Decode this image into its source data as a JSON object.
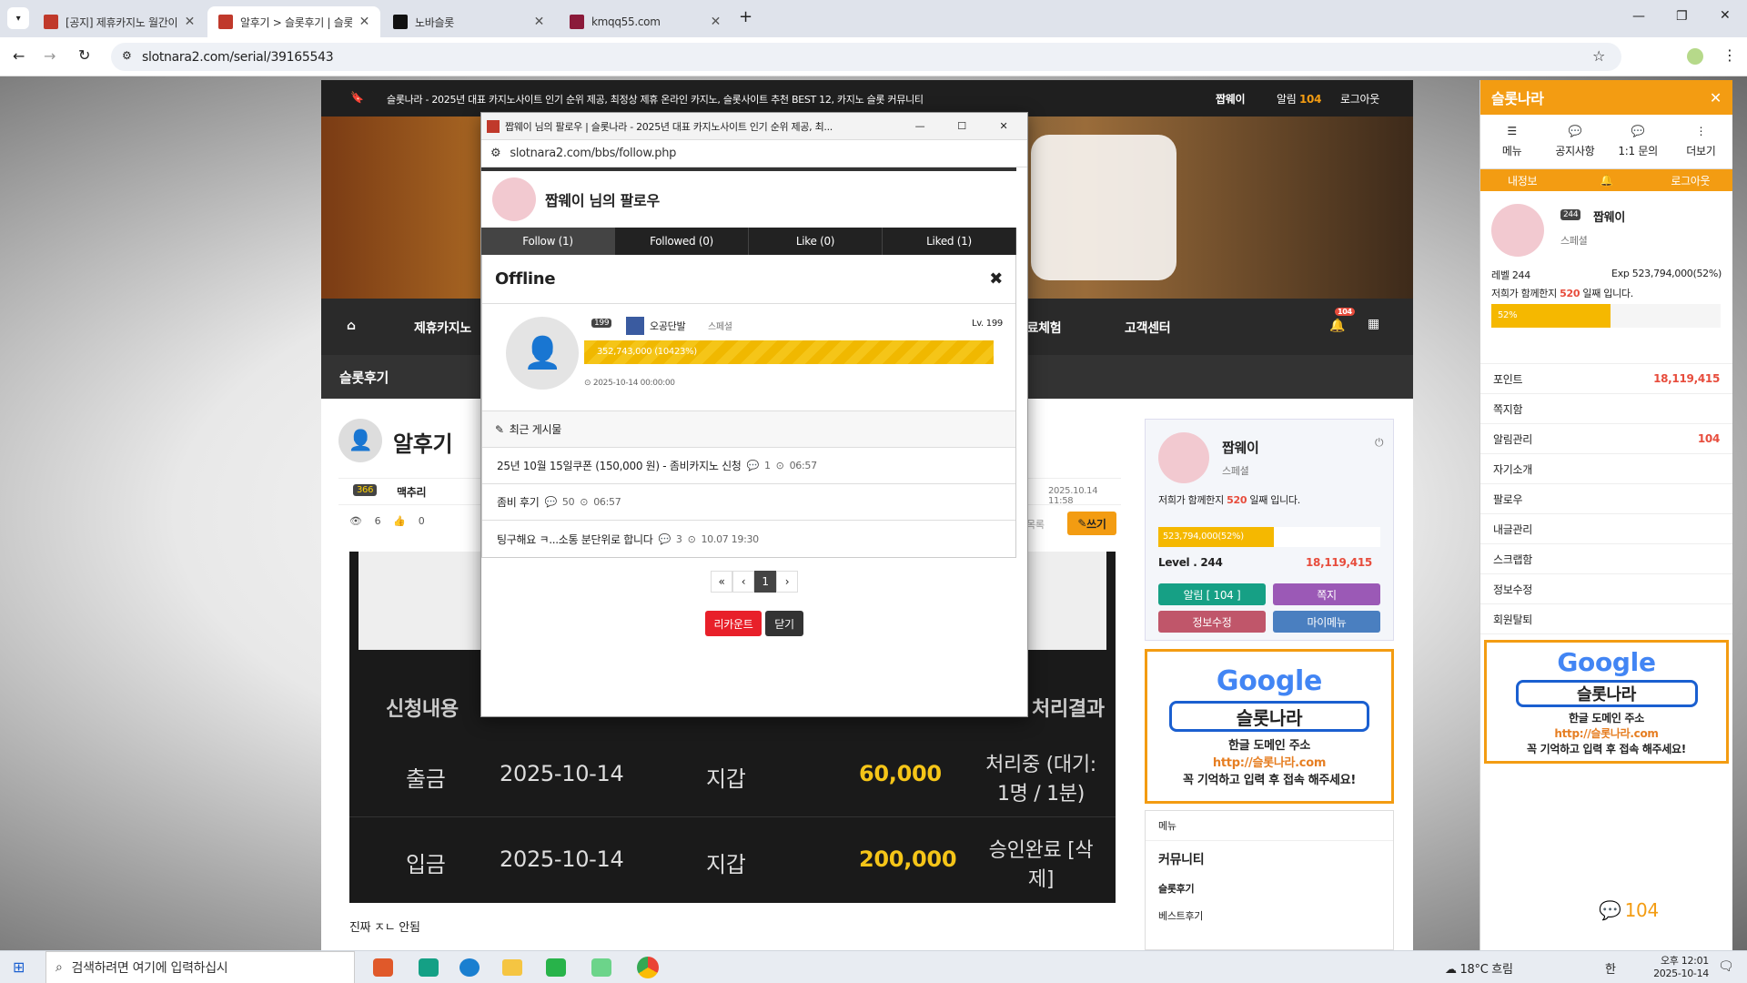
{
  "tabs": [
    {
      "title": "[공지] 제휴카지노 월간이벤트",
      "favicon_color": "#c0392b"
    },
    {
      "title": "알후기 > 슬롯후기 | 슬롯나라",
      "favicon_color": "#c0392b"
    },
    {
      "title": "노바슬롯",
      "favicon_color": "#111111"
    },
    {
      "title": "kmqq55.com",
      "favicon_color": "#8b1a3a"
    }
  ],
  "address": {
    "url": "slotnara2.com/serial/39165543"
  },
  "site": {
    "top_text": "슬롯나라 - 2025년 대표 카지노사이트 인기 순위 제공, 최정상 제휴 온라인 카지노, 슬롯사이트 추천 BEST 12, 카지노 슬롯 커뮤니티",
    "user": "짭웨이",
    "alarm_label": "알림",
    "alarm_count": "104",
    "logout": "로그아웃",
    "nav": [
      "제휴카지노",
      "무료체험",
      "고객센터"
    ],
    "nav_badge": "104",
    "section": "슬롯후기",
    "post_title": "알후기",
    "author_level": "366",
    "author": "맥추리",
    "post_date": "2025.10.14 11:58",
    "views": "6",
    "likes": "0",
    "write": "쓰기",
    "list_label": "목록",
    "table": {
      "header_left": "신청내용",
      "header_right": "처리결과",
      "rows": [
        {
          "type": "출금",
          "date": "2025-10-14",
          "wallet": "지갑",
          "amount": "60,000",
          "status": "처리중 (대기: 1명 / 1분)"
        },
        {
          "type": "입금",
          "date": "2025-10-14",
          "wallet": "지갑",
          "amount": "200,000",
          "status": "승인완료 [삭제]"
        }
      ]
    },
    "body_text": "진짜 ㅈㄴ 안됨"
  },
  "widget": {
    "name": "짭웨이",
    "rank": "스페셜",
    "days_text_a": "저희가 함께한지",
    "days": "520",
    "days_text_b": "일째 입니다.",
    "exp": "523,794,000(52%)",
    "level": "Level . 244",
    "points": "18,119,415",
    "buttons": [
      "알림 [ 104 ]",
      "쪽지",
      "정보수정",
      "마이메뉴"
    ],
    "menu_label": "메뉴",
    "community": "커뮤니티",
    "links": [
      "슬롯후기",
      "베스트후기"
    ]
  },
  "google_ad": {
    "logo": "Google",
    "search": "슬롯나라",
    "line1": "한글 도메인 주소",
    "url": "http://슬롯나라.com",
    "line2": "꼭 기억하고 입력 후 접속 해주세요!"
  },
  "sidebar": {
    "title": "슬롯나라",
    "icons": [
      "메뉴",
      "공지사항",
      "1:1 문의",
      "더보기"
    ],
    "tabs": [
      "내정보",
      "로그아웃"
    ],
    "name": "짭웨이",
    "level_badge": "244",
    "rank": "스페셜",
    "level": "레벨 244",
    "exp": "Exp 523,794,000(52%)",
    "days_text_a": "저희가 함께한지",
    "days": "520",
    "days_text_b": "일째 입니다.",
    "progress_label": "52%",
    "progress": 0.52,
    "rows": [
      {
        "label": "포인트",
        "value": "18,119,415"
      },
      {
        "label": "쪽지함",
        "value": ""
      },
      {
        "label": "알림관리",
        "value": "104"
      },
      {
        "label": "자기소개",
        "value": ""
      },
      {
        "label": "팔로우",
        "value": ""
      },
      {
        "label": "내글관리",
        "value": ""
      },
      {
        "label": "스크랩함",
        "value": ""
      },
      {
        "label": "정보수정",
        "value": ""
      },
      {
        "label": "회원탈퇴",
        "value": ""
      }
    ],
    "chat_count": "104"
  },
  "popup": {
    "window_title": "짭웨이 님의 팔로우 | 슬롯나라 - 2025년 대표 카지노사이트 인기 순위 제공, 최...",
    "url": "slotnara2.com/bbs/follow.php",
    "heading": "짭웨이 님의 팔로우",
    "tabs": [
      "Follow (1)",
      "Followed (0)",
      "Like (0)",
      "Liked (1)"
    ],
    "offline": "Offline",
    "member_level": "199",
    "member_name": "오공단발",
    "member_rank": "스페셜",
    "member_lv": "Lv. 199",
    "member_exp": "352,743,000 (10423%)",
    "member_date": "2025-10-14 00:00:00",
    "recent_label": "최근 게시물",
    "posts": [
      {
        "title": "25년 10월 15일쿠폰 (150,000 원) - 좀비카지노 신청",
        "comments": "1",
        "time": "06:57"
      },
      {
        "title": "좀비 후기",
        "comments": "50",
        "time": "06:57"
      },
      {
        "title": "팅구해요 ㅋ...소통 분단위로 합니다",
        "comments": "3",
        "time": "10.07 19:30"
      }
    ],
    "page": "1",
    "recount": "리카운트",
    "close": "닫기"
  },
  "taskbar": {
    "search": "검색하려면 여기에 입력하십시",
    "weather": "18°C 흐림",
    "time": "오후 12:01",
    "date": "2025-10-14",
    "ime": "한"
  }
}
